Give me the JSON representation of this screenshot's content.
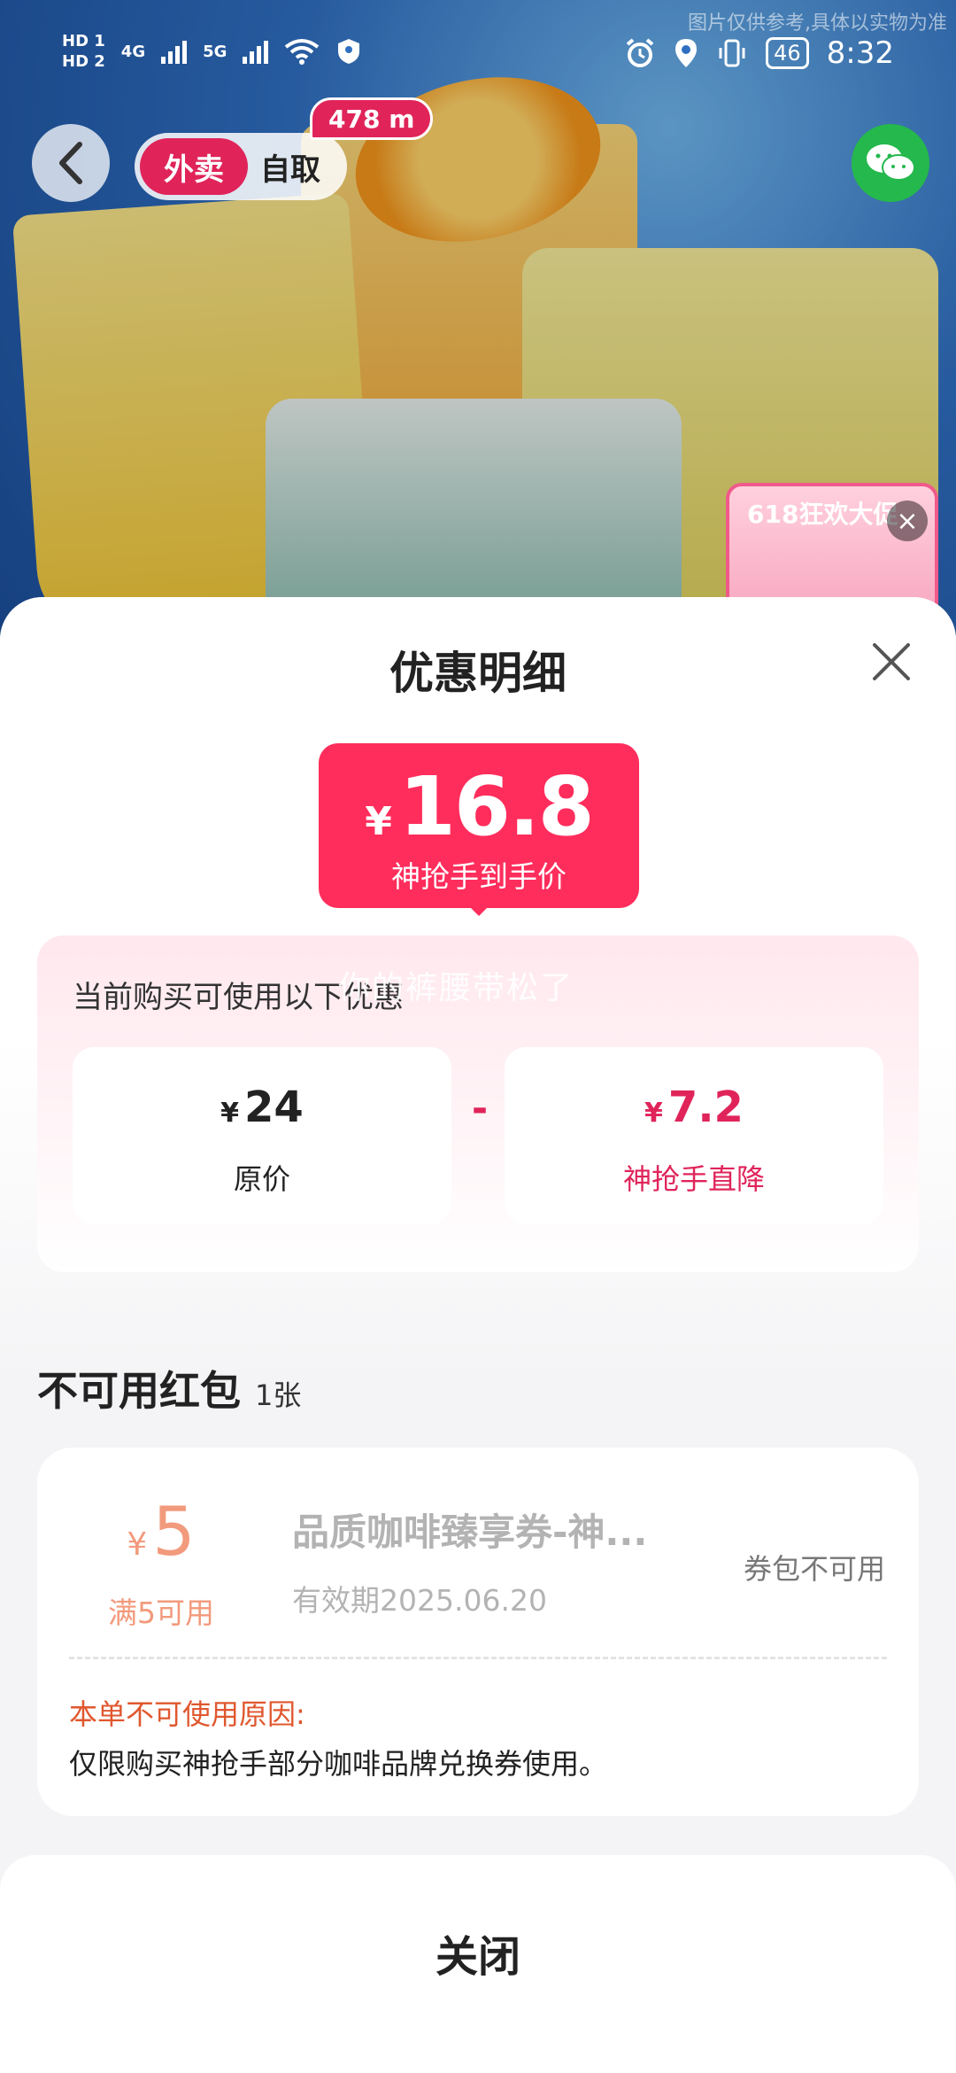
{
  "status_bar": {
    "hd1": "HD 1",
    "hd2": "HD 2",
    "net1": "4G",
    "net2": "5G",
    "battery": "46",
    "time": "8:32"
  },
  "hero": {
    "watermark": "图片仅供参考,具体以实物为准",
    "mode_active": "外卖",
    "mode_inactive": "自取",
    "distance": "478 m",
    "promo_float_text": "618狂欢大促"
  },
  "sheet": {
    "title": "优惠明细",
    "final_price": {
      "currency": "¥",
      "value": "16.8",
      "label": "神抢手到手价"
    },
    "hint": "当前购买可使用以下优惠",
    "overlay_text": "你的裤腰带松了",
    "original": {
      "currency": "¥",
      "value": "24",
      "label": "原价"
    },
    "minus": "-",
    "discount": {
      "currency": "¥",
      "value": "7.2",
      "label": "神抢手直降"
    },
    "unavailable_title": "不可用红包",
    "unavailable_count": "1张",
    "coupon": {
      "currency": "¥",
      "value": "5",
      "condition": "满5可用",
      "name": "品质咖啡臻享券-神...",
      "expiry": "有效期2025.06.20",
      "status": "券包不可用",
      "reason_title": "本单不可使用原因:",
      "reason": "仅限购买神抢手部分咖啡品牌兑换券使用。"
    },
    "close_label": "关闭"
  },
  "colors": {
    "accent": "#ff2d5c",
    "brand_red": "#e0245a",
    "coupon_orange": "#f29a7c",
    "reason_orange": "#e0572e",
    "wechat_green": "#25b84c"
  }
}
